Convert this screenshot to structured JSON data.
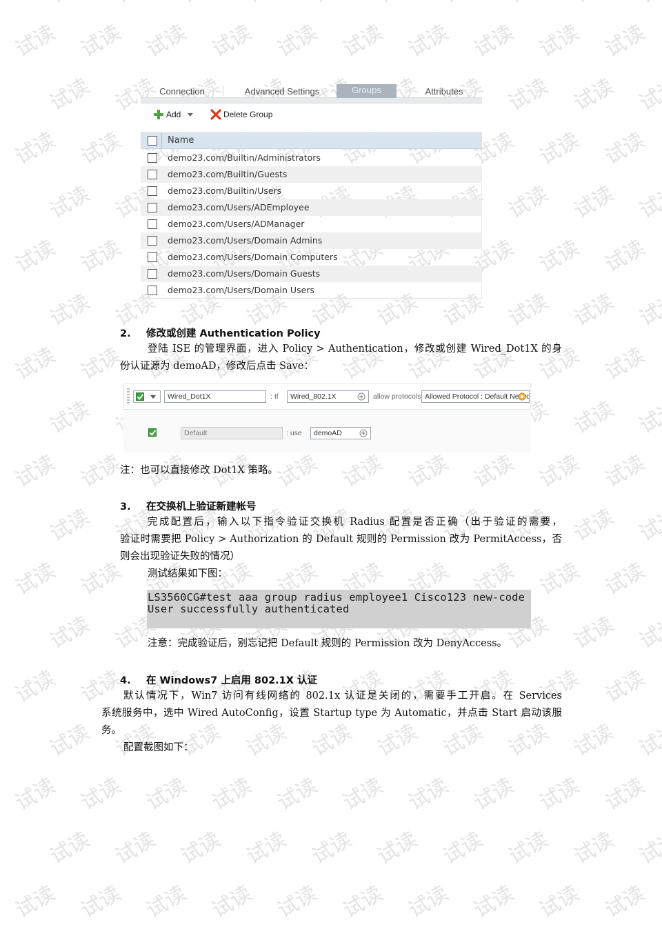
{
  "watermark": {
    "text": "试读",
    "color": "#e3e3e3"
  },
  "groups_panel": {
    "tabs": [
      {
        "label": "Connection",
        "active": false
      },
      {
        "label": "Advanced Settings",
        "active": false
      },
      {
        "label": "Groups",
        "active": true
      },
      {
        "label": "Attributes",
        "active": false
      }
    ],
    "toolbar": {
      "add_label": "Add",
      "delete_label": "Delete Group"
    },
    "column_header": "Name",
    "rows": [
      "demo23.com/Builtin/Administrators",
      "demo23.com/Builtin/Guests",
      "demo23.com/Builtin/Users",
      "demo23.com/Users/ADEmployee",
      "demo23.com/Users/ADManager",
      "demo23.com/Users/Domain Admins",
      "demo23.com/Users/Domain Computers",
      "demo23.com/Users/Domain Guests",
      "demo23.com/Users/Domain Users"
    ]
  },
  "section2": {
    "number": "2.",
    "title": "修改或创建 Authentication Policy",
    "lines": [
      "登陆 ISE 的管理界面，进入 Policy > Authentication，修改或创建 Wired_Dot1X 的身",
      "份认证源为 demoAD，修改后点击 Save："
    ]
  },
  "policy_panel": {
    "rule_name": "Wired_Dot1X",
    "if_label": ": If",
    "condition": "Wired_802.1X",
    "allow_label": "allow protocols",
    "protocols": "Allowed Protocol : Default Netwo",
    "default_name": "Default",
    "use_label": ": use",
    "identity_source": "demoAD"
  },
  "note1": "注：也可以直接修改 Dot1X 策略。",
  "section3": {
    "number": "3.",
    "title": "在交换机上验证新建帐号",
    "lines": [
      "完成配置后，输入以下指令验证交换机 Radius 配置是否正确（出于验证的需要，",
      "验证时需要把 Policy > Authorization 的 Default 规则的 Permission 改为 PermitAccess，否",
      "则会出现验证失败的情况）",
      "测试结果如下图："
    ]
  },
  "terminal": {
    "lines": [
      "LS3560CG#test aaa group radius employee1 Cisco123 new-code",
      "User successfully authenticated"
    ]
  },
  "note2": "注意：完成验证后，别忘记把 Default 规则的 Permission 改为 DenyAccess。",
  "section4": {
    "number": "4.",
    "title": "在 Windows7 上启用 802.1X 认证",
    "lines": [
      "默认情况下，Win7 访问有线网络的 802.1x 认证是关闭的，需要手工开启。在 Services",
      "系统服务中，选中 Wired AutoConfig，设置 Startup type 为 Automatic，并点击 Start 启动该服",
      "务。",
      "配置截图如下："
    ]
  }
}
